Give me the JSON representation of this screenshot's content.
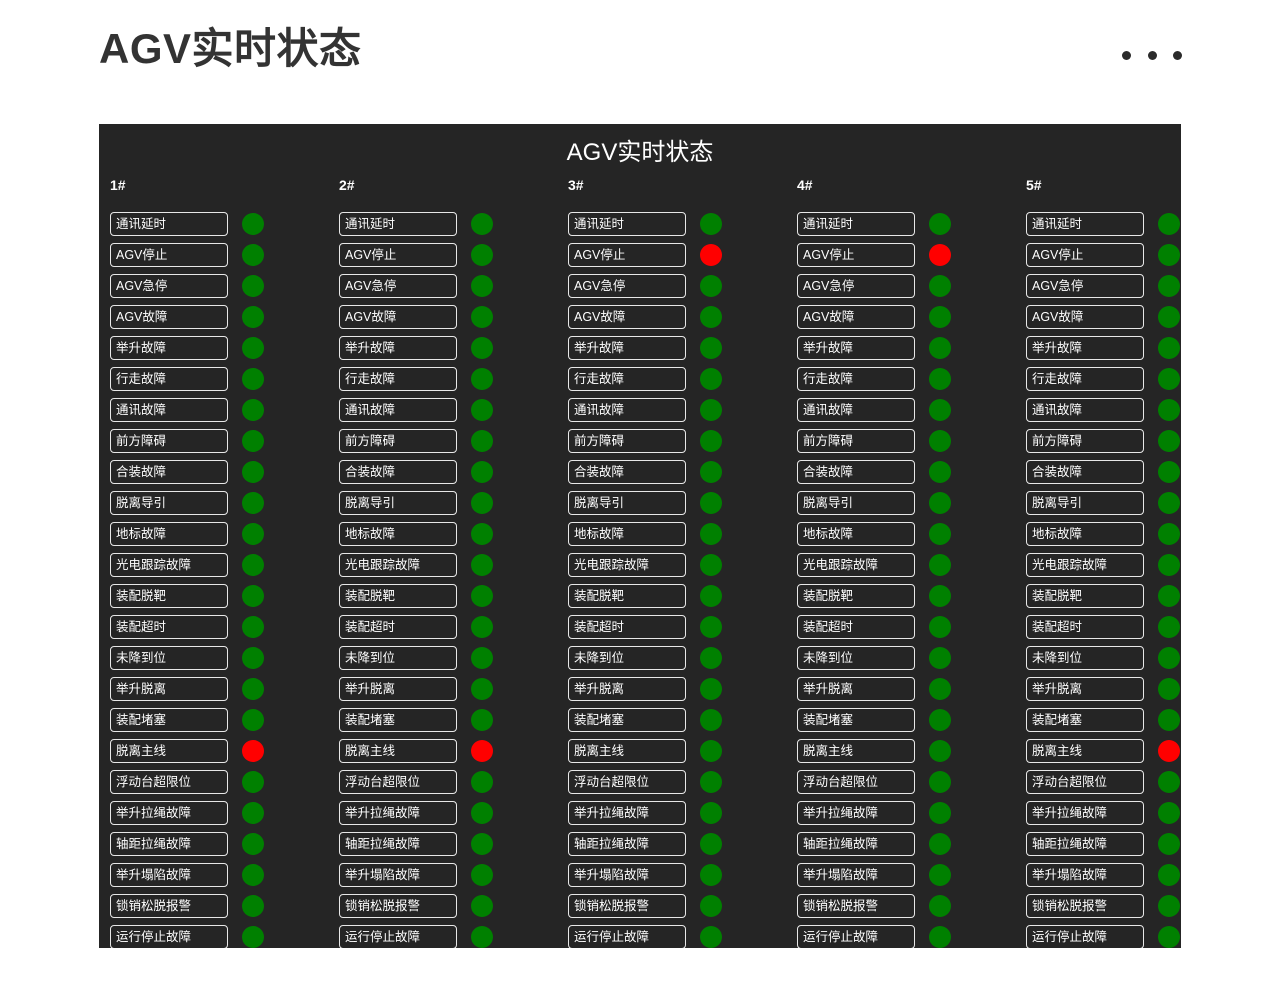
{
  "header": {
    "title": "AGV实时状态",
    "more_icon": "ellipsis-icon",
    "dots": [
      "•",
      "•",
      "•"
    ]
  },
  "panel": {
    "title": "AGV实时状态",
    "background_color": "#252525",
    "status_colors": {
      "normal": "#008000",
      "alarm": "#ff0000"
    },
    "alarm_labels": [
      "通讯延时",
      "AGV停止",
      "AGV急停",
      "AGV故障",
      "举升故障",
      "行走故障",
      "通讯故障",
      "前方障碍",
      "合装故障",
      "脱离导引",
      "地标故障",
      "光电跟踪故障",
      "装配脱靶",
      "装配超时",
      "未降到位",
      "举升脱离",
      "装配堵塞",
      "脱离主线",
      "浮动台超限位",
      "举升拉绳故障",
      "轴距拉绳故障",
      "举升塌陷故障",
      "锁销松脱报警",
      "运行停止故障"
    ],
    "columns": [
      {
        "name": "1#",
        "statuses": [
          "green",
          "green",
          "green",
          "green",
          "green",
          "green",
          "green",
          "green",
          "green",
          "green",
          "green",
          "green",
          "green",
          "green",
          "green",
          "green",
          "green",
          "red",
          "green",
          "green",
          "green",
          "green",
          "green",
          "green"
        ]
      },
      {
        "name": "2#",
        "statuses": [
          "green",
          "green",
          "green",
          "green",
          "green",
          "green",
          "green",
          "green",
          "green",
          "green",
          "green",
          "green",
          "green",
          "green",
          "green",
          "green",
          "green",
          "red",
          "green",
          "green",
          "green",
          "green",
          "green",
          "green"
        ]
      },
      {
        "name": "3#",
        "statuses": [
          "green",
          "red",
          "green",
          "green",
          "green",
          "green",
          "green",
          "green",
          "green",
          "green",
          "green",
          "green",
          "green",
          "green",
          "green",
          "green",
          "green",
          "green",
          "green",
          "green",
          "green",
          "green",
          "green",
          "green"
        ]
      },
      {
        "name": "4#",
        "statuses": [
          "green",
          "red",
          "green",
          "green",
          "green",
          "green",
          "green",
          "green",
          "green",
          "green",
          "green",
          "green",
          "green",
          "green",
          "green",
          "green",
          "green",
          "green",
          "green",
          "green",
          "green",
          "green",
          "green",
          "green"
        ]
      },
      {
        "name": "5#",
        "statuses": [
          "green",
          "green",
          "green",
          "green",
          "green",
          "green",
          "green",
          "green",
          "green",
          "green",
          "green",
          "green",
          "green",
          "green",
          "green",
          "green",
          "green",
          "red",
          "green",
          "green",
          "green",
          "green",
          "green",
          "green"
        ]
      }
    ]
  }
}
